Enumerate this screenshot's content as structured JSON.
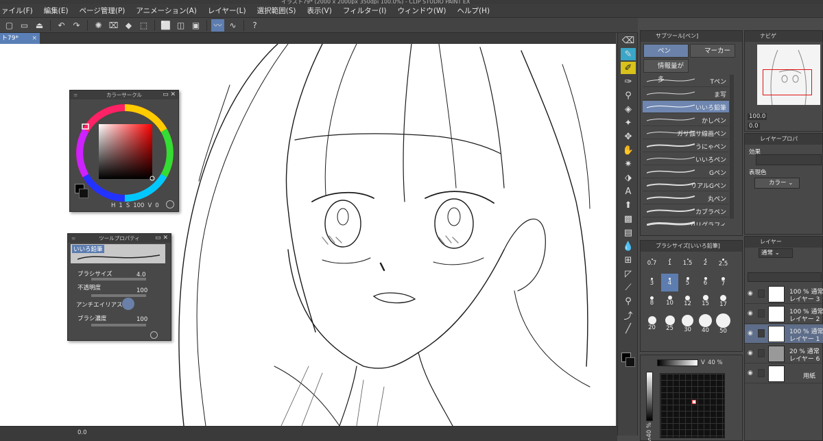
{
  "window": {
    "title": "イラスト79* (2000 x 2000px 350dpi 100.0%) - CLIP STUDIO PAINT EX"
  },
  "menu": [
    "ァイル(F)",
    "編集(E)",
    "ページ管理(P)",
    "アニメーション(A)",
    "レイヤー(L)",
    "選択範囲(S)",
    "表示(V)",
    "フィルター(I)",
    "ウィンドウ(W)",
    "ヘルプ(H)"
  ],
  "document_tab": {
    "label": "ト79*",
    "close": "×"
  },
  "color_circle": {
    "title": "カラーサークル",
    "h_label": "H",
    "h_value": "1",
    "s_label": "S",
    "s_value": "100",
    "v_label": "V",
    "v_value": "0"
  },
  "tool_property": {
    "title": "ツールプロパティ",
    "tool_name": "いいろ鉛筆",
    "rows": [
      {
        "label": "ブラシサイズ",
        "value": "4.0"
      },
      {
        "label": "不透明度",
        "value": "100"
      },
      {
        "label": "アンチエイリアス",
        "value": ""
      },
      {
        "label": "ブラシ濃度",
        "value": "100"
      }
    ]
  },
  "sub_tool": {
    "header": "サブツール[ペン]",
    "tabs": [
      "ペン",
      "マーカー"
    ],
    "info_button": "情報量が多",
    "brushes": [
      "Tペン",
      "ま写",
      "いいろ鉛筆",
      "かしペン",
      "ガサ伽サ線画ペン",
      "うにゃペン",
      "いいろペン",
      "Gペン",
      "リアルGペン",
      "丸ペン",
      "カブラペン",
      "カリグラフィ"
    ],
    "selected": "いいろ鉛筆"
  },
  "brush_size": {
    "header": "ブラシサイズ[いいろ鉛筆]",
    "sizes": [
      "0.7",
      "1",
      "1.5",
      "2",
      "2.5",
      "3",
      "4",
      "5",
      "6",
      "7",
      "8",
      "10",
      "12",
      "15",
      "17",
      "20",
      "25",
      "30",
      "40",
      "50"
    ],
    "selected": "4"
  },
  "color_picker": {
    "v_label": "V",
    "v_value": "40 %",
    "s_label": "S",
    "s_value": "40 %"
  },
  "navigator": {
    "tab": "ナビゲ",
    "zoom": "100.0",
    "rotate": "0.0"
  },
  "layer_property": {
    "tab": "レイヤープロパ",
    "effect_label": "効果",
    "expression_label": "表現色",
    "expression_value": "カラー"
  },
  "layer_panel": {
    "tab": "レイヤー",
    "blend_mode": "通常",
    "layers": [
      {
        "opacity": "100 %",
        "mode": "通常",
        "name": "レイヤー 3"
      },
      {
        "opacity": "100 %",
        "mode": "通常",
        "name": "レイヤー 2"
      },
      {
        "opacity": "100 %",
        "mode": "通常",
        "name": "レイヤー 1"
      },
      {
        "opacity": "20 %",
        "mode": "通常",
        "name": "レイヤー 6"
      },
      {
        "opacity": "",
        "mode": "",
        "name": "用紙"
      }
    ]
  },
  "status": {
    "zoom": "0.0"
  },
  "colors": {
    "accent": "#5d7db0",
    "panel": "#484848",
    "dark": "#3a3a3a"
  }
}
